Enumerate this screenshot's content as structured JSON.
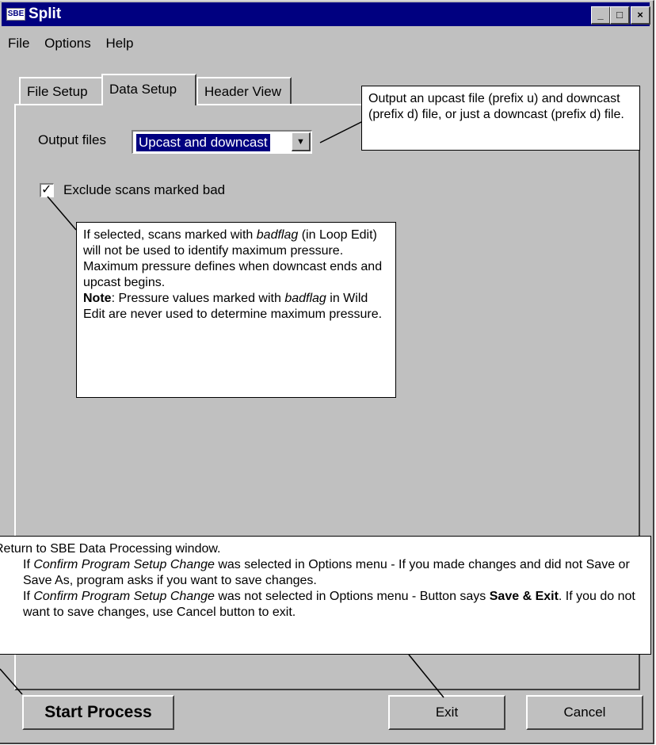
{
  "window": {
    "title": "Split",
    "icon_label": "SBE",
    "minimize_glyph": "_",
    "maximize_glyph": "□",
    "close_glyph": "×"
  },
  "menu": [
    "File",
    "Options",
    "Help"
  ],
  "tabs": [
    {
      "label": "File Setup"
    },
    {
      "label": "Data Setup"
    },
    {
      "label": "Header View"
    }
  ],
  "form": {
    "output_files_label": "Output files",
    "output_files_value": "Upcast and downcast",
    "exclude_label": "Exclude scans marked bad",
    "exclude_checked_glyph": "✓"
  },
  "callouts": {
    "output": "Output an upcast file (prefix u) and downcast (prefix d) file, or just a downcast (prefix d) file.",
    "exclude": {
      "p1_a": "If selected, scans marked with ",
      "p1_em": "badflag",
      "p1_b": " (in Loop Edit) will not be used to identify maximum pressure. Maximum pressure defines when downcast ends and upcast begins.",
      "note_bold": "Note",
      "note_a": ": Pressure values marked with ",
      "note_em": "badflag",
      "note_b": " in Wild Edit are never used to determine maximum pressure."
    },
    "exit": {
      "line1": "Return to SBE Data Processing window.",
      "b1_pre": "If ",
      "b1_em": "Confirm Program Setup Change",
      "b1_post": " was selected in Options menu - If you made changes and did not Save or Save As, program asks if you want to save changes.",
      "b2_pre": "If ",
      "b2_em": "Confirm Program Setup Change",
      "b2_mid": " was not selected in Options menu - Button says ",
      "b2_bold": "Save & Exit",
      "b2_post": ". If you do not want to save changes, use Cancel button to exit."
    }
  },
  "buttons": {
    "start": "Start Process",
    "exit": "Exit",
    "cancel": "Cancel"
  }
}
